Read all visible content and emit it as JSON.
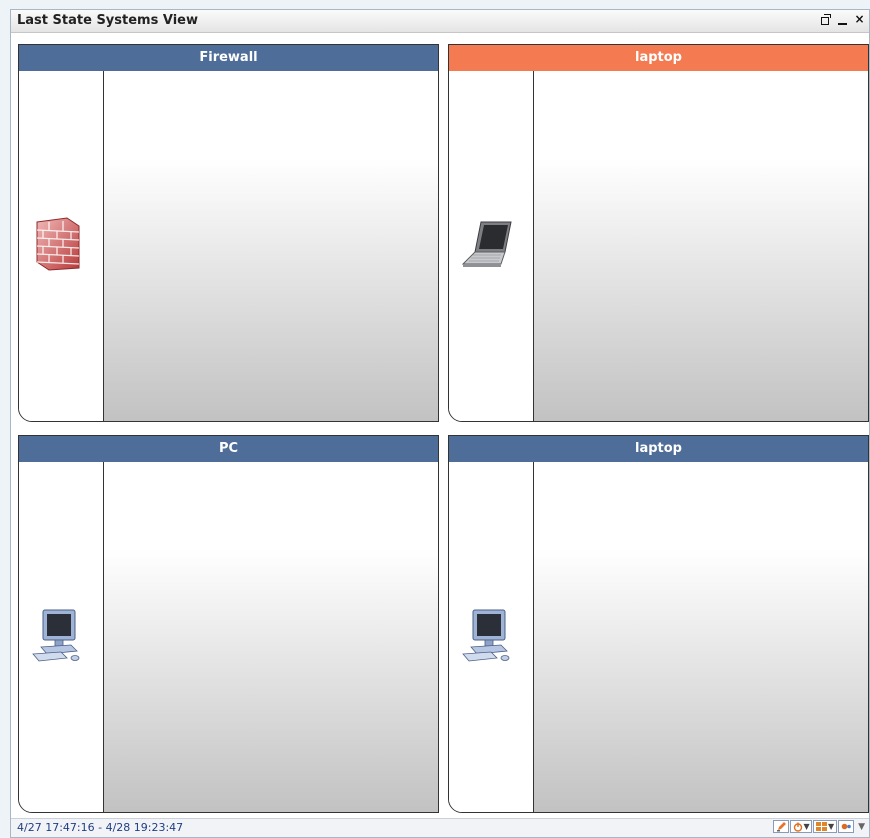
{
  "window": {
    "title": "Last State Systems View",
    "controls": [
      "restore-icon",
      "minimize-icon",
      "close-icon"
    ],
    "close_label": "×"
  },
  "panels": [
    {
      "title": "Firewall",
      "icon": "firewall-icon",
      "header_color": "#4e6d99"
    },
    {
      "title": "laptop",
      "icon": "laptop-icon",
      "header_color": "#f47a52"
    },
    {
      "title": "PC",
      "icon": "desktop-pc-icon",
      "header_color": "#4e6d99"
    },
    {
      "title": "laptop",
      "icon": "desktop-pc-icon",
      "header_color": "#4e6d99"
    }
  ],
  "status": {
    "time_range": "4/27 17:47:16 - 4/28 19:23:47",
    "tools": [
      "edit-icon",
      "power-icon",
      "layout-icon",
      "record-icon",
      "more-dropdown-icon"
    ]
  }
}
